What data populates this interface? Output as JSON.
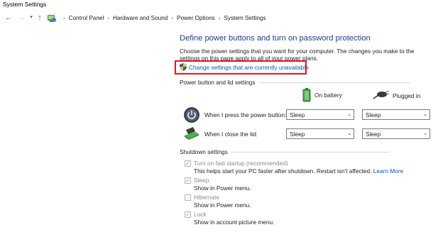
{
  "window": {
    "title": "System Settings"
  },
  "address": {
    "crumbs": [
      "Control Panel",
      "Hardware and Sound",
      "Power Options",
      "System Settings"
    ]
  },
  "main": {
    "heading": "Define power buttons and turn on password protection",
    "description": "Choose the power settings that you want for your computer. The changes you make to the settings on this page apply to all of your power plans.",
    "change_link": "Change settings that are currently unavailable"
  },
  "power_section": {
    "title": "Power button and lid settings",
    "on_battery": "On battery",
    "plugged_in": "Plugged in",
    "rows": [
      {
        "label": "When I press the power button:",
        "battery": "Sleep",
        "plugged": "Sleep",
        "icon": "power-button-icon"
      },
      {
        "label": "When I close the lid:",
        "battery": "Sleep",
        "plugged": "Sleep",
        "icon": "laptop-lid-icon"
      }
    ]
  },
  "shutdown_section": {
    "title": "Shutdown settings",
    "options": [
      {
        "label": "Turn on fast startup (recommended)",
        "checked": true,
        "desc": "This helps start your PC faster after shutdown. Restart isn't affected.",
        "link": "Learn More"
      },
      {
        "label": "Sleep",
        "checked": true,
        "desc": "Show in Power menu."
      },
      {
        "label": "Hibernate",
        "checked": false,
        "desc": "Show in Power menu."
      },
      {
        "label": "Lock",
        "checked": true,
        "desc": "Show in account picture menu."
      }
    ]
  },
  "colors": {
    "heading": "#1a3c8f",
    "link": "#0a58b8",
    "highlight": "#e8141b"
  }
}
